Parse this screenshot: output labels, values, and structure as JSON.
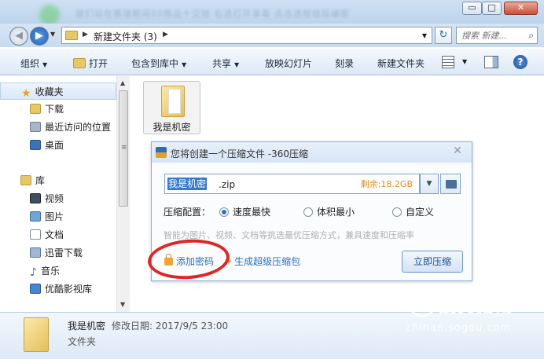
{
  "window": {
    "blurred_title": "我们站在赛瑞期间00商品十交链  右选打开录毒  点击选按组段编密",
    "minimize_glyph": "▭",
    "maximize_glyph": "□",
    "close_glyph": "✕"
  },
  "address": {
    "back_glyph": "◀",
    "forward_glyph": "▶",
    "breadcrumb": "新建文件夹 (3)",
    "refresh_glyph": "↻",
    "search_placeholder": "搜索 新建...",
    "search_glyph": "⌕"
  },
  "toolbar": {
    "organize": "组织",
    "open": "打开",
    "include_in_library": "包含到库中",
    "share": "共享",
    "slideshow": "放映幻灯片",
    "burn": "刻录",
    "new_folder": "新建文件夹",
    "help_glyph": "?"
  },
  "navpane": {
    "favorites": "收藏夹",
    "downloads": "下载",
    "recent_places": "最近访问的位置",
    "desktop": "桌面",
    "libraries": "库",
    "videos": "视频",
    "pictures": "图片",
    "documents": "文档",
    "xunlei": "迅雷下载",
    "music": "音乐",
    "youku": "优酷影视库"
  },
  "content": {
    "folder_name": "我是机密"
  },
  "dialog": {
    "title": "您将创建一个压缩文件 -360压缩",
    "close_glyph": "✕",
    "filename_selected": "我是机密",
    "filename_ext": ".zip",
    "remaining": "剩余:18.2GB",
    "config_label": "压缩配置：",
    "options": [
      "速度最快",
      "体积最小",
      "自定义"
    ],
    "selected_option": "速度最快",
    "hint": "智能为图片、视频、文档等挑选最优压缩方式，兼具速度和压缩率",
    "add_password": "添加密码",
    "create_sfx": "生成超级压缩包",
    "compress_now": "立即压缩"
  },
  "details": {
    "name": "我是机密",
    "modified_label": "修改日期:",
    "modified_value": "2017/9/5 23:00",
    "type": "文件夹"
  },
  "watermark": {
    "logo_glyph": "S",
    "brand": "搜狗指南",
    "url": "zhinan.sogou.com"
  },
  "colors": {
    "accent": "#2a6ebd",
    "annotation_circle": "#e02525",
    "remaining_text": "#e58b1e"
  }
}
